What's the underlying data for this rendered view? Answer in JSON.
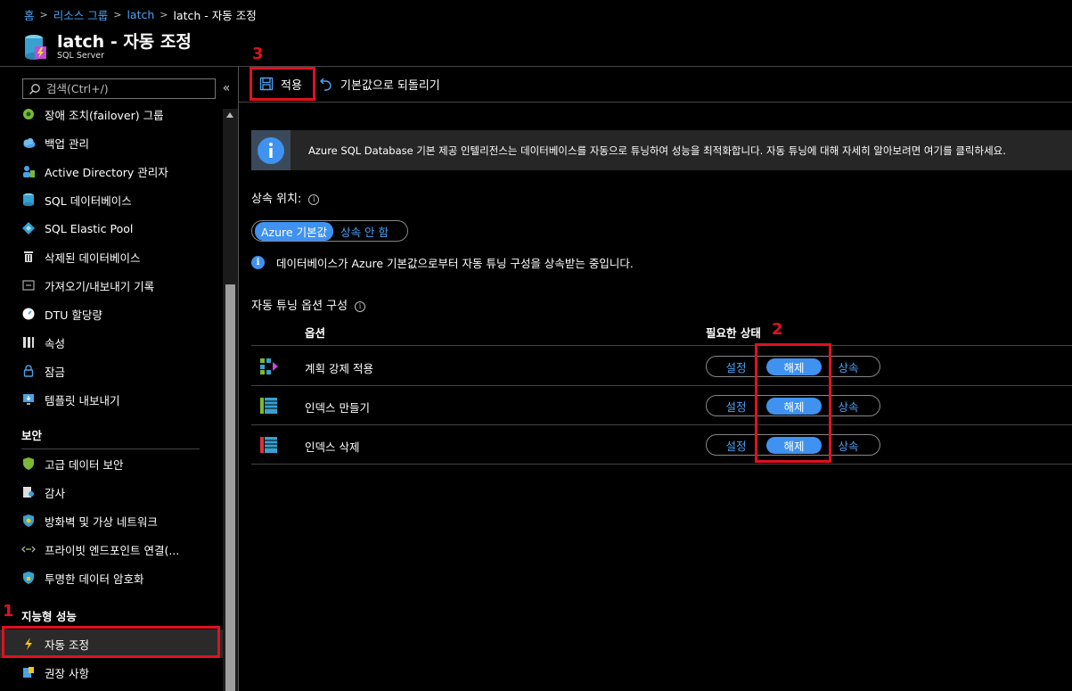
{
  "breadcrumb": {
    "home": "홈",
    "resource_groups": "리소스 그룹",
    "server": "latch",
    "current": "latch - 자동 조정"
  },
  "header": {
    "title": "latch - 자동 조정",
    "subtitle": "SQL Server"
  },
  "sidebar": {
    "search_placeholder": "검색(Ctrl+/)",
    "collapse": "«",
    "items": [
      {
        "label": "장애 조치(failover) 그룹",
        "icon": "failover-icon"
      },
      {
        "label": "백업 관리",
        "icon": "cloud-backup-icon"
      },
      {
        "label": "Active Directory 관리자",
        "icon": "ad-admin-icon"
      },
      {
        "label": "SQL 데이터베이스",
        "icon": "sql-database-icon"
      },
      {
        "label": "SQL Elastic Pool",
        "icon": "elastic-pool-icon"
      },
      {
        "label": "삭제된 데이터베이스",
        "icon": "trash-icon"
      },
      {
        "label": "가져오기/내보내기 기록",
        "icon": "import-export-icon"
      },
      {
        "label": "DTU 할당량",
        "icon": "gauge-icon"
      },
      {
        "label": "속성",
        "icon": "properties-icon"
      },
      {
        "label": "잠금",
        "icon": "lock-icon"
      },
      {
        "label": "템플릿 내보내기",
        "icon": "template-export-icon"
      }
    ],
    "security_header": "보안",
    "security_items": [
      {
        "label": "고급 데이터 보안",
        "icon": "shield-icon"
      },
      {
        "label": "감사",
        "icon": "audit-icon"
      },
      {
        "label": "방화벽 및 가상 네트워크",
        "icon": "firewall-icon"
      },
      {
        "label": "프라이빗 엔드포인트 연결(...",
        "icon": "endpoint-icon"
      },
      {
        "label": "투명한 데이터 암호화",
        "icon": "encryption-icon"
      }
    ],
    "intelligent_header": "지능형 성능",
    "intelligent_items": [
      {
        "label": "자동 조정",
        "icon": "lightning-icon"
      },
      {
        "label": "권장 사항",
        "icon": "recommendations-icon"
      }
    ]
  },
  "toolbar": {
    "apply": "적용",
    "revert": "기본값으로 되돌리기"
  },
  "banner": {
    "text": "Azure SQL Database 기본 제공 인텔리전스는 데이터베이스를 자동으로 튜닝하여 성능을 최적화합니다. 자동 튜닝에 대해 자세히 알아보려면 여기를 클릭하세요."
  },
  "inherit": {
    "label": "상속 위치:",
    "azure_default": "Azure 기본값",
    "no_inherit": "상속 안 함",
    "note": "데이터베이스가 Azure 기본값으로부터 자동 튜닝 구성을 상속받는 중입니다."
  },
  "tuning": {
    "section_label": "자동 튜닝 옵션 구성",
    "col_option": "옵션",
    "col_state": "필요한 상태",
    "rows": [
      {
        "label": "계획 강제 적용",
        "icon": "plan-force-icon",
        "set": "설정",
        "off": "해제",
        "inherit": "상속"
      },
      {
        "label": "인덱스 만들기",
        "icon": "index-create-icon",
        "set": "설정",
        "off": "해제",
        "inherit": "상속"
      },
      {
        "label": "인덱스 삭제",
        "icon": "index-delete-icon",
        "set": "설정",
        "off": "해제",
        "inherit": "상속"
      }
    ]
  },
  "annotations": {
    "one": "1",
    "two": "2",
    "three": "3"
  },
  "colors": {
    "accent": "#3f92f0",
    "link": "#4ba3f5",
    "annotation": "#e0101f"
  }
}
